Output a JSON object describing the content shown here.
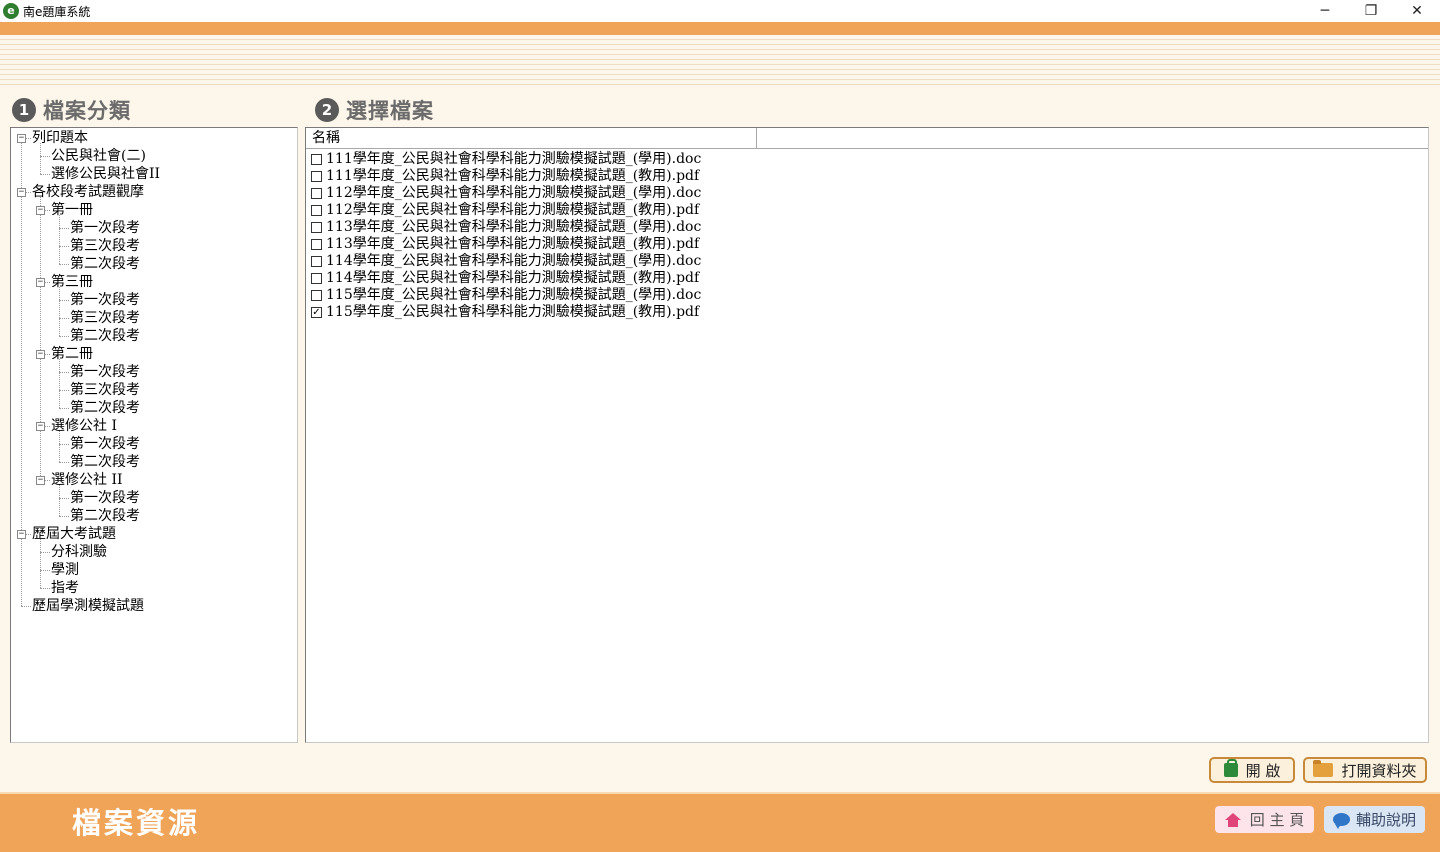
{
  "window": {
    "title": "南e題庫系統",
    "icon_letter": "e",
    "minimize_glyph": "─",
    "restore_glyph": "❐",
    "close_glyph": "✕"
  },
  "sections": {
    "category": {
      "number": "1",
      "title": "檔案分類"
    },
    "select": {
      "number": "2",
      "title": "選擇檔案"
    }
  },
  "tree": {
    "nodes": [
      {
        "label": "列印題本",
        "level": 0,
        "toggle": "−"
      },
      {
        "label": "公民與社會(二)",
        "level": 1
      },
      {
        "label": "選修公民與社會II",
        "level": 1
      },
      {
        "label": "各校段考試題觀摩",
        "level": 0,
        "toggle": "−"
      },
      {
        "label": "第一冊",
        "level": 1,
        "toggle": "−"
      },
      {
        "label": "第一次段考",
        "level": 2
      },
      {
        "label": "第三次段考",
        "level": 2
      },
      {
        "label": "第二次段考",
        "level": 2
      },
      {
        "label": "第三冊",
        "level": 1,
        "toggle": "−"
      },
      {
        "label": "第一次段考",
        "level": 2
      },
      {
        "label": "第三次段考",
        "level": 2
      },
      {
        "label": "第二次段考",
        "level": 2
      },
      {
        "label": "第二冊",
        "level": 1,
        "toggle": "−"
      },
      {
        "label": "第一次段考",
        "level": 2
      },
      {
        "label": "第三次段考",
        "level": 2
      },
      {
        "label": "第二次段考",
        "level": 2
      },
      {
        "label": "選修公社 I",
        "level": 1,
        "toggle": "−"
      },
      {
        "label": "第一次段考",
        "level": 2
      },
      {
        "label": "第二次段考",
        "level": 2
      },
      {
        "label": "選修公社 II",
        "level": 1,
        "toggle": "−"
      },
      {
        "label": "第一次段考",
        "level": 2
      },
      {
        "label": "第二次段考",
        "level": 2
      },
      {
        "label": "歷屆大考試題",
        "level": 0,
        "toggle": "−"
      },
      {
        "label": "分科測驗",
        "level": 1
      },
      {
        "label": "學測",
        "level": 1
      },
      {
        "label": "指考",
        "level": 1
      },
      {
        "label": "歷屆學測模擬試題",
        "level": 0
      }
    ]
  },
  "file_list": {
    "column_name": "名稱",
    "check_glyph": "✓",
    "files": [
      {
        "name": "111學年度_公民與社會科學科能力測驗模擬試題_(學用).doc",
        "checked": false
      },
      {
        "name": "111學年度_公民與社會科學科能力測驗模擬試題_(教用).pdf",
        "checked": false
      },
      {
        "name": "112學年度_公民與社會科學科能力測驗模擬試題_(學用).doc",
        "checked": false
      },
      {
        "name": "112學年度_公民與社會科學科能力測驗模擬試題_(教用).pdf",
        "checked": false
      },
      {
        "name": "113學年度_公民與社會科學科能力測驗模擬試題_(學用).doc",
        "checked": false
      },
      {
        "name": "113學年度_公民與社會科學科能力測驗模擬試題_(教用).pdf",
        "checked": false
      },
      {
        "name": "114學年度_公民與社會科學科能力測驗模擬試題_(學用).doc",
        "checked": false
      },
      {
        "name": "114學年度_公民與社會科學科能力測驗模擬試題_(教用).pdf",
        "checked": false
      },
      {
        "name": "115學年度_公民與社會科學科能力測驗模擬試題_(學用).doc",
        "checked": false
      },
      {
        "name": "115學年度_公民與社會科學科能力測驗模擬試題_(教用).pdf",
        "checked": true
      }
    ]
  },
  "actions": {
    "open_label": "開 啟",
    "open_folder_label": "打開資料夾"
  },
  "footer": {
    "title": "檔案資源",
    "home_label": "回 主 頁",
    "help_label": "輔助說明"
  },
  "colors": {
    "accent_orange": "#f0a458",
    "background": "#fdf6ea",
    "open_icon_green": "#2d8a3b",
    "home_icon_pink": "#e0457a",
    "help_icon_blue": "#2f76c9"
  }
}
